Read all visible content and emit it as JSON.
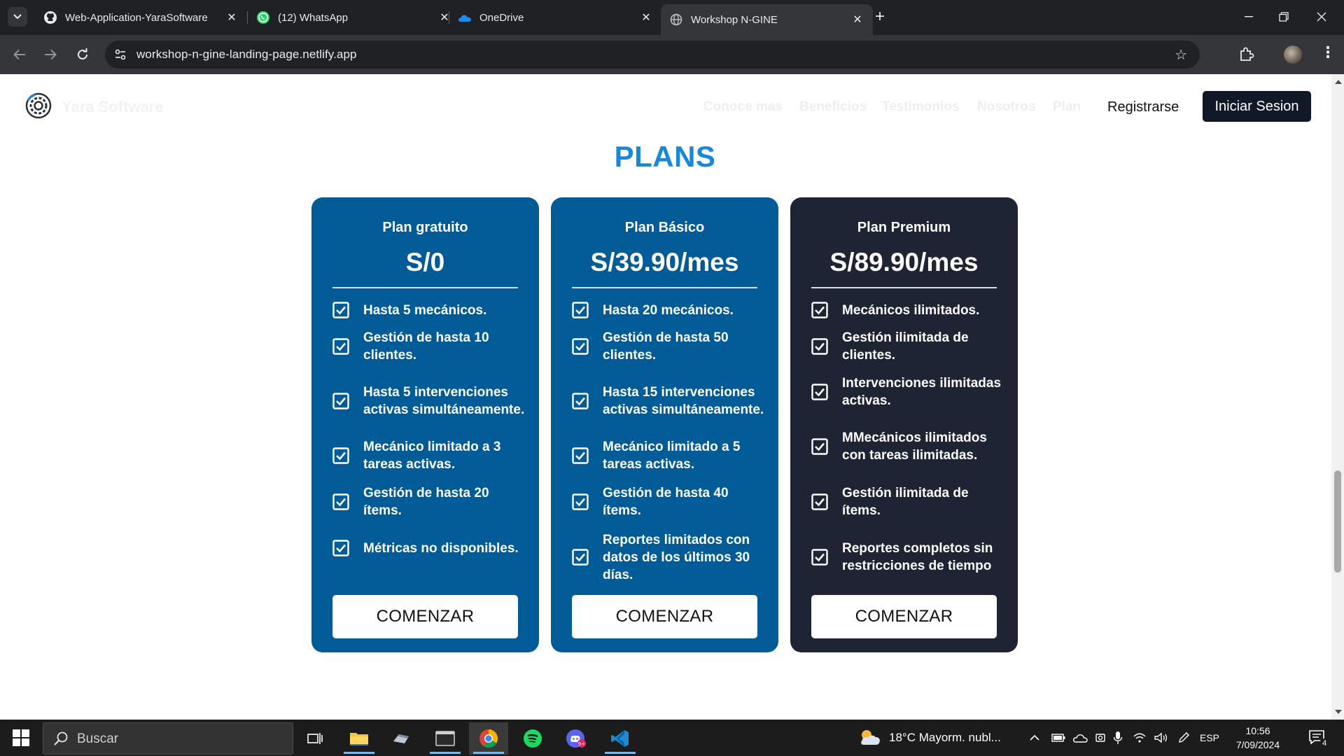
{
  "browser": {
    "tabs": [
      {
        "title": "Web-Application-YaraSoftware",
        "icon": "github-icon",
        "active": false
      },
      {
        "title": "(12) WhatsApp",
        "icon": "whatsapp-icon",
        "active": false
      },
      {
        "title": "OneDrive",
        "icon": "onedrive-icon",
        "active": false
      },
      {
        "title": "Workshop N-GINE",
        "icon": "globe-icon",
        "active": true
      }
    ],
    "url": "workshop-n-gine-landing-page.netlify.app"
  },
  "site": {
    "brand": "Yara Software",
    "nav": [
      "Conoce mas",
      "Beneficios",
      "Testimonios",
      "Nosotros",
      "Plan"
    ],
    "register_label": "Registrarse",
    "login_label": "Iniciar Sesion",
    "section_title": "PLANS",
    "plans": [
      {
        "name": "Plan gratuito",
        "price": "S/0",
        "theme": "#015b96",
        "features": [
          "Hasta 5 mecánicos.",
          "Gestión de hasta 10 clientes.",
          "Hasta 5 intervenciones activas simultáneamente.",
          "Mecánico limitado a 3 tareas activas.",
          "Gestión de hasta 20 ítems.",
          "Métricas no disponibles."
        ],
        "cta": "COMENZAR"
      },
      {
        "name": "Plan Básico",
        "price": "S/39.90/mes",
        "theme": "#015b96",
        "features": [
          "Hasta 20 mecánicos.",
          "Gestión de hasta 50 clientes.",
          "Hasta 15 intervenciones activas simultáneamente.",
          "Mecánico limitado a 5 tareas activas.",
          "Gestión de hasta 40 ítems.",
          "Reportes limitados con datos de los últimos 30 días."
        ],
        "cta": "COMENZAR"
      },
      {
        "name": "Plan Premium",
        "price": "S/89.90/mes",
        "theme": "#1e2433",
        "features": [
          "Mecánicos ilimitados.",
          "Gestión ilimitada de clientes.",
          "Intervenciones ilimitadas activas.",
          "MMecánicos ilimitados con tareas ilimitadas.",
          "Gestión ilimitada de ítems.",
          "Reportes completos sin restricciones de tiempo"
        ],
        "cta": "COMENZAR"
      }
    ]
  },
  "taskbar": {
    "search_placeholder": "Buscar",
    "weather": "18°C  Mayorm. nubl...",
    "language": "ESP",
    "time": "10:56",
    "date": "7/09/2024",
    "notification_count": "4",
    "pinned": [
      "task-view-icon",
      "file-explorer-icon",
      "app-icon",
      "terminal-icon",
      "chrome-icon",
      "spotify-icon",
      "discord-icon",
      "vscode-icon"
    ]
  },
  "colors": {
    "accent_title": "#1a88d9",
    "card_blue": "#015b96",
    "card_dark": "#1e2433",
    "login_button": "#111827"
  }
}
